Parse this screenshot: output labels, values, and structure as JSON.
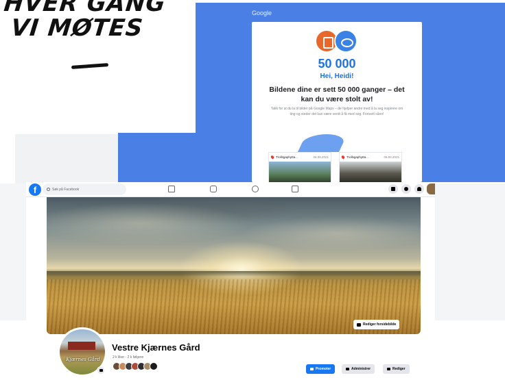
{
  "headline": {
    "line1": "HVER GANG",
    "line2": "VI MØTES"
  },
  "google_email": {
    "brand": "Google",
    "count": "50 000",
    "greeting": "Hei, Heidi!",
    "headline": "Bildene dine er sett 50 000 ganger – det kan du være stolt av!",
    "body": "Takk for at du la til bilder på Google Maps – de hjelper andre med å la seg inspirere om ting og steder det kan være verdt å få med seg. Fortsett sånn!",
    "thumbnails": [
      {
        "place": "Trollsgaphytta...",
        "date": "06.06.2021"
      },
      {
        "place": "Trollsgaphytta...",
        "date": "06.06.2021"
      }
    ],
    "colors": {
      "accent": "#4a7fe6",
      "count": "#1a73e8"
    }
  },
  "facebook": {
    "search_placeholder": "Søk på Facebook",
    "nav_icons": [
      "home-icon",
      "watch-icon",
      "groups-icon",
      "gaming-icon"
    ],
    "right_icons": [
      "menu-icon",
      "messenger-icon",
      "notifications-icon"
    ],
    "cover_button": "Rediger forsidebilde",
    "profile_sign": "Kjærnes Gård",
    "page_name": "Vestre Kjærnes Gård",
    "stats": "2 k liker · 2 k følgere",
    "buttons": {
      "promote": "Promoter",
      "admin": "Administrer",
      "edit": "Rediger"
    },
    "colors": {
      "brand": "#1877f2"
    }
  }
}
